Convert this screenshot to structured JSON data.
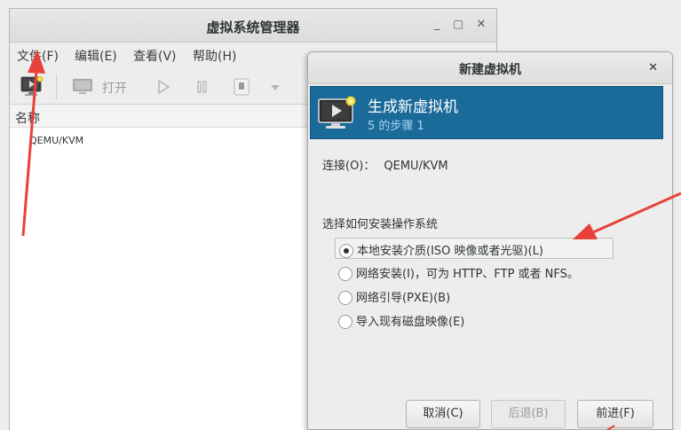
{
  "main_window": {
    "title": "虚拟系统管理器",
    "menu": [
      "文件(F)",
      "编辑(E)",
      "查看(V)",
      "帮助(H)"
    ],
    "toolbar": {
      "open_label": "打开"
    },
    "column_header": "名称",
    "connection_name": "QEMU/KVM"
  },
  "dialog": {
    "title": "新建虚拟机",
    "banner_title": "生成新虚拟机",
    "banner_step": "5 的步骤 1",
    "connection_label": "连接(O)：",
    "connection_value": "QEMU/KVM",
    "method_title": "选择如何安装操作系统",
    "options": [
      {
        "label": "本地安装介质(ISO 映像或者光驱)(L)",
        "checked": true
      },
      {
        "label": "网络安装(I)，可为 HTTP、FTP 或者 NFS。",
        "checked": false
      },
      {
        "label": "网络引导(PXE)(B)",
        "checked": false
      },
      {
        "label": "导入现有磁盘映像(E)",
        "checked": false
      }
    ],
    "buttons": {
      "cancel": "取消(C)",
      "back": "后退(B)",
      "forward": "前进(F)"
    }
  },
  "colors": {
    "banner_bg": "#1a6a9a",
    "banner_step_text": "#a8d6f2",
    "annotation_arrow": "#e8413a"
  }
}
